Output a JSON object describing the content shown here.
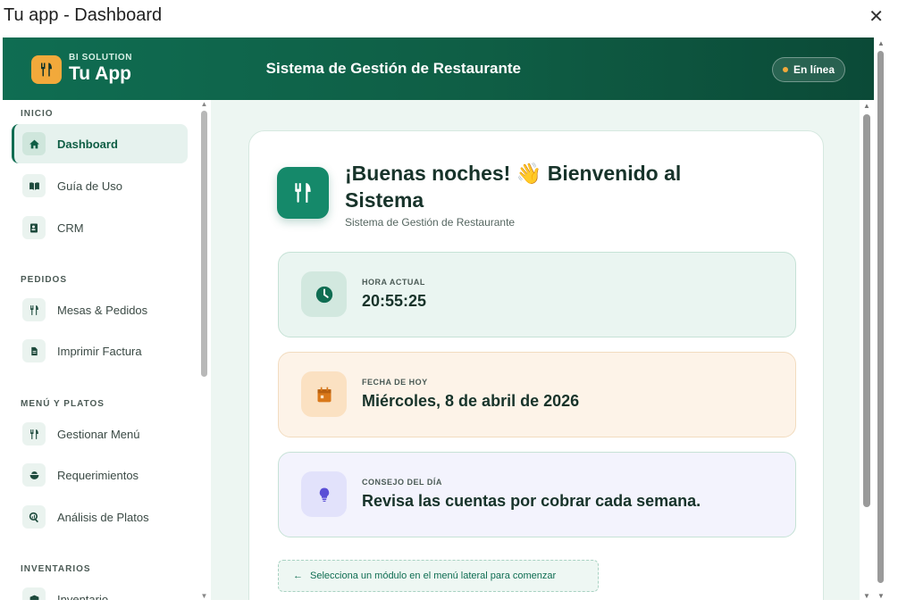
{
  "window": {
    "title": "Tu app - Dashboard",
    "close_glyph": "✕"
  },
  "header": {
    "brand_sub": "BI SOLUTION",
    "brand_name": "Tu App",
    "brand_icon": "utensils-icon",
    "title": "Sistema de Gestión de Restaurante",
    "status": "En línea"
  },
  "sidebar": {
    "sections": [
      {
        "label": "INICIO"
      },
      {
        "label": "PEDIDOS"
      },
      {
        "label": "MENÚ Y PLATOS"
      },
      {
        "label": "INVENTARIOS"
      }
    ],
    "items": [
      {
        "label": "Dashboard",
        "icon": "home-icon",
        "active": true
      },
      {
        "label": "Guía de Uso",
        "icon": "book-icon"
      },
      {
        "label": "CRM",
        "icon": "contact-card-icon"
      },
      {
        "label": "Mesas & Pedidos",
        "icon": "utensils-icon"
      },
      {
        "label": "Imprimir Factura",
        "icon": "document-icon"
      },
      {
        "label": "Gestionar Menú",
        "icon": "utensils-icon"
      },
      {
        "label": "Requerimientos",
        "icon": "bowl-icon"
      },
      {
        "label": "Análisis de Platos",
        "icon": "magnifier-chart-icon"
      },
      {
        "label": "Inventario",
        "icon": "box-icon"
      }
    ]
  },
  "main": {
    "greeting": "¡Buenas noches! 👋 Bienvenido al Sistema",
    "subtitle": "Sistema de Gestión de Restaurante",
    "cards": [
      {
        "label": "HORA ACTUAL",
        "value": "20:55:25",
        "icon": "clock-icon",
        "color": "#0f6d52"
      },
      {
        "label": "FECHA DE HOY",
        "value": "Miércoles, 8 de abril de 2026",
        "icon": "calendar-icon",
        "color": "#d9781a"
      },
      {
        "label": "CONSEJO DEL DÍA",
        "value": "Revisa las cuentas por cobrar cada semana.",
        "icon": "lightbulb-icon",
        "color": "#5a4fd6"
      }
    ],
    "hint": "Selecciona un módulo en el menú lateral para comenzar",
    "hint_arrow": "←"
  },
  "colors": {
    "brand": "#0f6d52",
    "accent": "#f2a93b",
    "background": "#edf6f2"
  }
}
